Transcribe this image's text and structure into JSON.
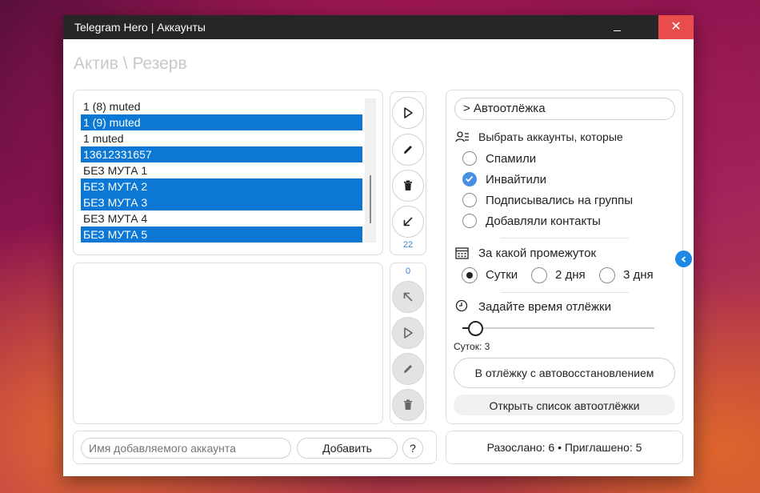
{
  "window": {
    "title": "Telegram Hero | Аккаунты",
    "close_glyph": "✕"
  },
  "page_title": "Актив \\ Резерв",
  "accounts": [
    {
      "name": "1 (8) muted",
      "selected": false
    },
    {
      "name": "1 (9) muted",
      "selected": true
    },
    {
      "name": "1 muted",
      "selected": false
    },
    {
      "name": "13612331657",
      "selected": true
    },
    {
      "name": "БЕЗ МУТА 1",
      "selected": false
    },
    {
      "name": "БЕЗ МУТА 2",
      "selected": true
    },
    {
      "name": "БЕЗ МУТА 3",
      "selected": true
    },
    {
      "name": "БЕЗ МУТА 4",
      "selected": false
    },
    {
      "name": "БЕЗ МУТА 5",
      "selected": true
    }
  ],
  "active_count": "22",
  "reserve_count": "0",
  "add_account": {
    "placeholder": "Имя добавляемого аккаунта",
    "button": "Добавить",
    "help": "?"
  },
  "autootlezhka": {
    "header": "> Автоотлёжка",
    "select_label": "Выбрать аккаунты, которые",
    "options": [
      {
        "label": "Спамили",
        "checked": false
      },
      {
        "label": "Инвайтили",
        "checked": true
      },
      {
        "label": "Подписывались на группы",
        "checked": false
      },
      {
        "label": "Добавляли контакты",
        "checked": false
      }
    ],
    "period_label": "За какой промежуток",
    "periods": [
      {
        "label": "Сутки",
        "checked": true
      },
      {
        "label": "2 дня",
        "checked": false
      },
      {
        "label": "3 дня",
        "checked": false
      }
    ],
    "time_label": "Задайте время отлёжки",
    "slider_value": 3,
    "slider_caption": "Суток: 3",
    "restore_button": "В отлёжку с автовосстановлением",
    "open_list_button": "Открыть список автоотлёжки"
  },
  "stats": "Разослано: 6 • Приглашено: 5",
  "colors": {
    "accent": "#0a78d4",
    "close": "#e84c4c",
    "titlebar": "#262626",
    "count": "#3b86d6"
  }
}
